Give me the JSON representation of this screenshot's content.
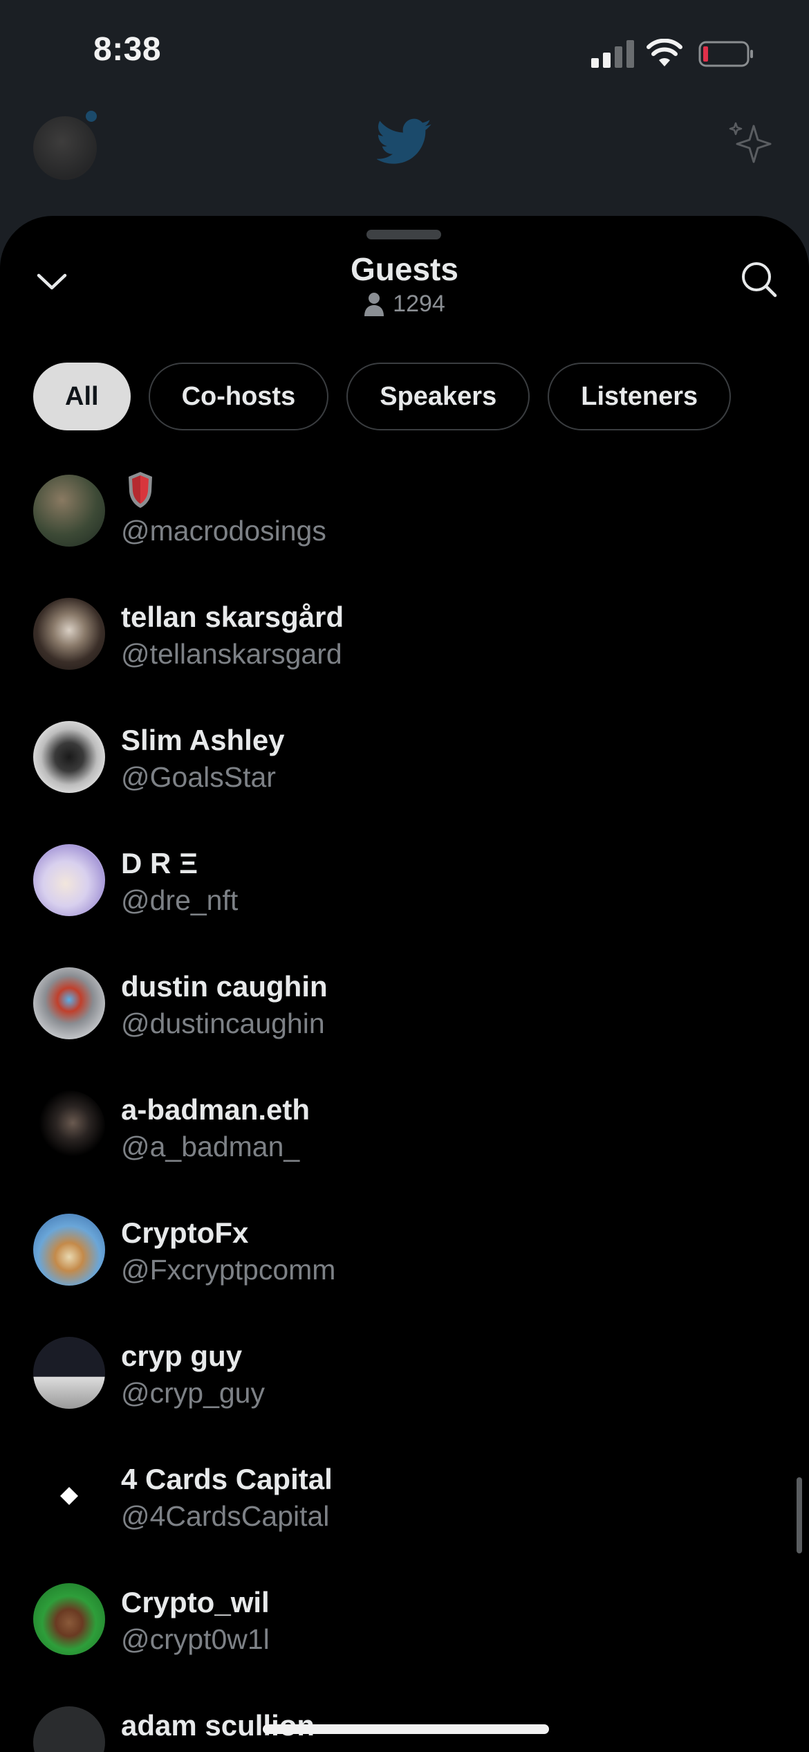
{
  "status_bar": {
    "time": "8:38"
  },
  "background": {
    "logo_icon": "twitter-bird-icon",
    "sparkle_icon": "sparkle-icon"
  },
  "sheet": {
    "title": "Guests",
    "count": "1294",
    "tabs": [
      {
        "label": "All",
        "active": true
      },
      {
        "label": "Co-hosts",
        "active": false
      },
      {
        "label": "Speakers",
        "active": false
      },
      {
        "label": "Listeners",
        "active": false
      }
    ],
    "guests": [
      {
        "name": "",
        "handle": "@macrodosings",
        "avatar_color": "#4a5a3e"
      },
      {
        "name": "tellan skarsgård",
        "handle": "@tellanskarsgard",
        "avatar_color": "#3a2e28"
      },
      {
        "name": "Slim Ashley",
        "handle": "@GoalsStar",
        "avatar_color": "#8a8a8a"
      },
      {
        "name": "D R Ξ",
        "handle": "@dre_nft",
        "avatar_color": "#c9c3e8"
      },
      {
        "name": "dustin caughin",
        "handle": "@dustincaughin",
        "avatar_color": "#7a7e86"
      },
      {
        "name": "a-badman.eth",
        "handle": "@a_badman_",
        "avatar_color": "#0b0b0b"
      },
      {
        "name": "CryptoFx",
        "handle": "@Fxcryptpcomm",
        "avatar_color": "#5a8fc4"
      },
      {
        "name": "cryp guy",
        "handle": "@cryp_guy",
        "avatar_color": "#1a1c22"
      },
      {
        "name": "4 Cards Capital",
        "handle": "@4CardsCapital",
        "avatar_color": "#000000"
      },
      {
        "name": "Crypto_wil",
        "handle": "@crypt0w1l",
        "avatar_color": "#2e9e3a"
      },
      {
        "name": "adam scullion",
        "handle": "",
        "avatar_color": "#2a2c2e"
      }
    ]
  }
}
